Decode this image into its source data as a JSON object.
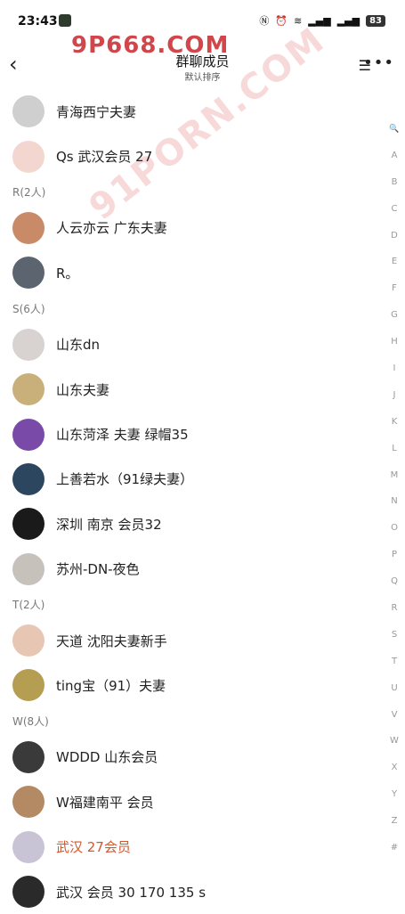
{
  "status": {
    "time": "23:43",
    "battery": "83"
  },
  "header": {
    "title": "群聊成员",
    "subtitle": "默认排序"
  },
  "watermarks": {
    "top": "9P668.COM",
    "diag": "91PORN.COM"
  },
  "list": [
    {
      "type": "member",
      "name": "青海西宁夫妻",
      "color": "#cfcfcf"
    },
    {
      "type": "member",
      "name": "Qs  武汉会员  27",
      "color": "#f3d6cf"
    },
    {
      "type": "section",
      "label": "R(2人)"
    },
    {
      "type": "member",
      "name": "人云亦云   广东夫妻",
      "color": "#c98a68"
    },
    {
      "type": "member",
      "name": "R。",
      "color": "#5c6470"
    },
    {
      "type": "section",
      "label": "S(6人)"
    },
    {
      "type": "member",
      "name": "山东dn",
      "color": "#d8d3d0"
    },
    {
      "type": "member",
      "name": "山东夫妻",
      "color": "#c9b07a"
    },
    {
      "type": "member",
      "name": "山东菏泽 夫妻  绿帽35",
      "color": "#7a4aa8"
    },
    {
      "type": "member",
      "name": "上善若水（91绿夫妻）",
      "color": "#2d4660"
    },
    {
      "type": "member",
      "name": "深圳 南京 会员32",
      "color": "#1a1a1a"
    },
    {
      "type": "member",
      "name": "苏州-DN-夜色",
      "color": "#c7c1bb"
    },
    {
      "type": "section",
      "label": "T(2人)"
    },
    {
      "type": "member",
      "name": "天道 沈阳夫妻新手",
      "color": "#e8c6b4"
    },
    {
      "type": "member",
      "name": "ting宝（91）夫妻",
      "color": "#b59d52"
    },
    {
      "type": "section",
      "label": "W(8人)"
    },
    {
      "type": "member",
      "name": "WDDD  山东会员",
      "color": "#3a3a3a"
    },
    {
      "type": "member",
      "name": "W福建南平  会员",
      "color": "#b38a63"
    },
    {
      "type": "member",
      "name": "武汉 27会员",
      "color": "#c9c3d6",
      "accent": true
    },
    {
      "type": "member",
      "name": "武汉 会员  30 170 135 s",
      "color": "#2a2a2a"
    }
  ],
  "index": [
    "Q",
    "A",
    "B",
    "C",
    "D",
    "E",
    "F",
    "G",
    "H",
    "I",
    "J",
    "K",
    "L",
    "M",
    "N",
    "O",
    "P",
    "Q",
    "R",
    "S",
    "T",
    "U",
    "V",
    "W",
    "X",
    "Y",
    "Z",
    "#"
  ]
}
